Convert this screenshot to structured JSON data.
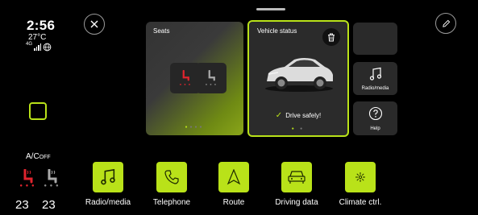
{
  "status": {
    "time": "2:56",
    "temperature": "27°C",
    "network": "4G"
  },
  "climate": {
    "ac_label": "A/C",
    "ac_state": "OFF",
    "left_temp": "23",
    "right_temp": "23"
  },
  "icons": {
    "close": "close-icon",
    "edit": "pencil-icon",
    "trash": "trash-icon",
    "note": "music-note-icon",
    "help": "question-icon",
    "phone": "phone-icon",
    "route": "navigation-arrow-icon",
    "car": "car-icon",
    "climate": "fan-icon"
  },
  "tiles": {
    "seats_title": "Seats",
    "vehicle_title": "Vehicle status",
    "vehicle_message": "Drive safely!",
    "radio_label": "Radio/media",
    "help_label": "Help"
  },
  "dock": [
    {
      "label": "Radio/media",
      "icon": "music-note-icon"
    },
    {
      "label": "Telephone",
      "icon": "phone-icon"
    },
    {
      "label": "Route",
      "icon": "navigation-arrow-icon"
    },
    {
      "label": "Driving data",
      "icon": "car-icon"
    },
    {
      "label": "Climate ctrl.",
      "icon": "fan-icon"
    }
  ],
  "colors": {
    "accent": "#b9e219",
    "seat_heat": "#e0242e",
    "tile_bg": "#2b2b2b",
    "background": "#000000"
  }
}
